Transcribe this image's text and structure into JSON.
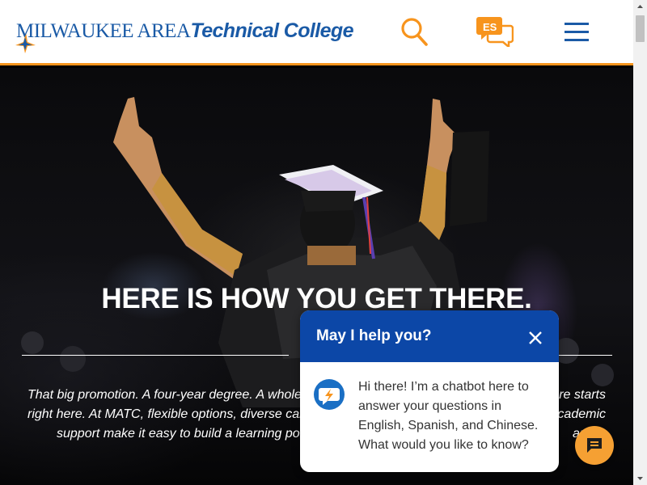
{
  "header": {
    "logo_part1_initial": "M",
    "logo_part1_rest": "ILWAUKEE ",
    "logo_part1_initial2": "A",
    "logo_part1_rest2": "REA",
    "logo_part2": "Technical College",
    "search_icon": "search-icon",
    "lang_label": "ES",
    "lang_icon": "speech-bubbles-icon",
    "menu_icon": "hamburger-menu-icon"
  },
  "hero": {
    "title": "HERE IS HOW YOU GET THERE.",
    "body_lines": [
      "That big promotion. A four-year degree. A whole",
      "re starts",
      "right here. At MATC, flexible options, diverse car",
      "academic",
      "support make it easy to build a learning po",
      "ant."
    ]
  },
  "chat": {
    "title": "May I help you?",
    "close_icon": "close-icon",
    "bot_icon": "chatbot-icon",
    "message": "Hi there! I’m a chatbot here to answer your questions in English, Spanish, and Chinese. What would you like to know?",
    "fab_icon": "chat-icon"
  },
  "colors": {
    "brand_blue": "#1a5aa6",
    "accent_orange": "#f7941d",
    "chat_header": "#0c47a7"
  }
}
